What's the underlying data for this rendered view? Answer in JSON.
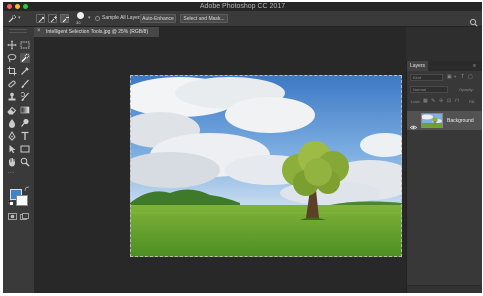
{
  "window": {
    "title": "Adobe Photoshop CC 2017",
    "traffic_lights": [
      "#fc5f57",
      "#fdbc2e",
      "#28c840"
    ]
  },
  "options_bar": {
    "brush_size": "30",
    "sample_all_layers_label": "Sample All Layers",
    "sample_all_layers_checked": false,
    "auto_enhance_label": "Auto-Enhance",
    "select_and_mask_label": "Select and Mask..."
  },
  "document_tab": {
    "close_glyph": "×",
    "title": "Intelligent Selection Tools.jpg @ 25% (RGB/8)"
  },
  "toolbar": {
    "more_tools_label": "...",
    "foreground_color": "#3f84c9",
    "background_color": "#ffffff"
  },
  "layers_panel": {
    "tab_label": "Layers",
    "kind_filter": "Kind",
    "blend_mode": "Normal",
    "opacity_label": "Opacity:",
    "lock_label": "Lock:",
    "fill_label": "Fill:",
    "layers": [
      {
        "name": "Background",
        "visible": true
      }
    ]
  }
}
